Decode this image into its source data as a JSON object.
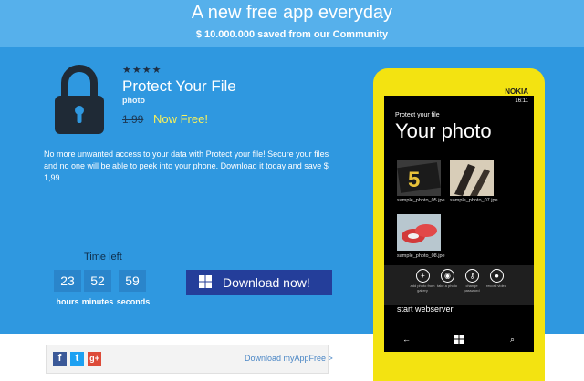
{
  "header": {
    "title": "A new free app everyday",
    "subtitle": "$ 10.000.000 saved from our Community"
  },
  "app": {
    "icon": "lock-icon",
    "stars": "★★★★",
    "name": "Protect Your File",
    "category": "photo",
    "old_price": "1.99",
    "now_free": "Now Free!",
    "description": "No more unwanted access to your data with Protect your file! Secure your files and no one will be able to peek into your phone. Download it today and save $ 1,99."
  },
  "countdown": {
    "label": "Time left",
    "hours": "23",
    "minutes": "52",
    "seconds": "59",
    "hours_label": "hours",
    "minutes_label": "minutes",
    "seconds_label": "seconds"
  },
  "download_button": "Download now!",
  "footer": {
    "social": [
      "f",
      "t",
      "g+"
    ],
    "download_link": "Download myAppFree >"
  },
  "phone": {
    "brand": "NOKIA",
    "time": "16:11",
    "app_title": "Protect your file",
    "page_title": "Your photo",
    "photos": [
      {
        "name": "sample_photo_05.jpg",
        "shown": "sample_photo_05.jpe"
      },
      {
        "name": "sample_photo_07.jpg",
        "shown": "sample_photo_07.jpe"
      },
      {
        "name": "sample_photo_08.jpg",
        "shown": "sample_photo_08.jpe"
      }
    ],
    "appbar": [
      {
        "icon": "plus-icon",
        "label": "add photo from gallery"
      },
      {
        "icon": "camera-icon",
        "label": "take a photo"
      },
      {
        "icon": "password-icon",
        "label": "change password"
      },
      {
        "icon": "record-icon",
        "label": "record video"
      }
    ],
    "menu_item": "start webserver",
    "colors": {
      "body": "#f3e311",
      "accent": "#3a9be0"
    }
  }
}
